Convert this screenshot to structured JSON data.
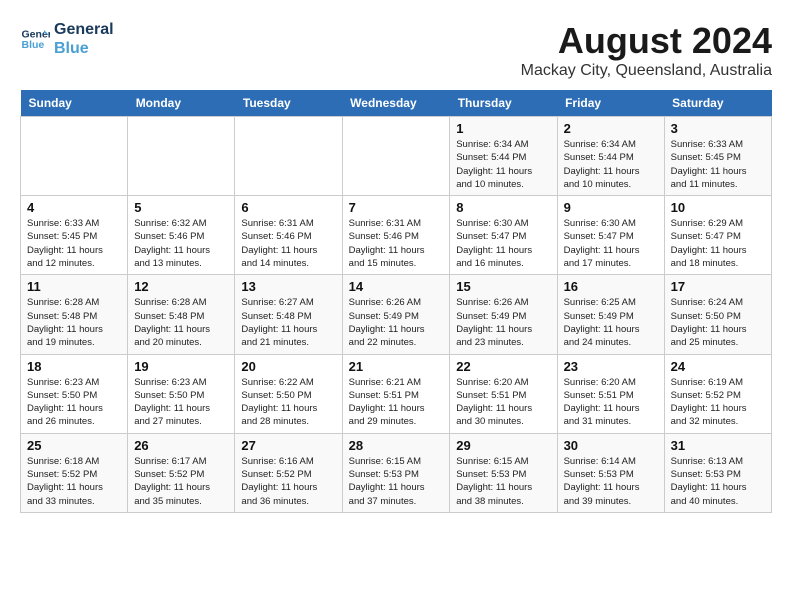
{
  "logo": {
    "line1": "General",
    "line2": "Blue"
  },
  "title": "August 2024",
  "subtitle": "Mackay City, Queensland, Australia",
  "days_of_week": [
    "Sunday",
    "Monday",
    "Tuesday",
    "Wednesday",
    "Thursday",
    "Friday",
    "Saturday"
  ],
  "weeks": [
    [
      {
        "day": "",
        "info": ""
      },
      {
        "day": "",
        "info": ""
      },
      {
        "day": "",
        "info": ""
      },
      {
        "day": "",
        "info": ""
      },
      {
        "day": "1",
        "info": "Sunrise: 6:34 AM\nSunset: 5:44 PM\nDaylight: 11 hours\nand 10 minutes."
      },
      {
        "day": "2",
        "info": "Sunrise: 6:34 AM\nSunset: 5:44 PM\nDaylight: 11 hours\nand 10 minutes."
      },
      {
        "day": "3",
        "info": "Sunrise: 6:33 AM\nSunset: 5:45 PM\nDaylight: 11 hours\nand 11 minutes."
      }
    ],
    [
      {
        "day": "4",
        "info": "Sunrise: 6:33 AM\nSunset: 5:45 PM\nDaylight: 11 hours\nand 12 minutes."
      },
      {
        "day": "5",
        "info": "Sunrise: 6:32 AM\nSunset: 5:46 PM\nDaylight: 11 hours\nand 13 minutes."
      },
      {
        "day": "6",
        "info": "Sunrise: 6:31 AM\nSunset: 5:46 PM\nDaylight: 11 hours\nand 14 minutes."
      },
      {
        "day": "7",
        "info": "Sunrise: 6:31 AM\nSunset: 5:46 PM\nDaylight: 11 hours\nand 15 minutes."
      },
      {
        "day": "8",
        "info": "Sunrise: 6:30 AM\nSunset: 5:47 PM\nDaylight: 11 hours\nand 16 minutes."
      },
      {
        "day": "9",
        "info": "Sunrise: 6:30 AM\nSunset: 5:47 PM\nDaylight: 11 hours\nand 17 minutes."
      },
      {
        "day": "10",
        "info": "Sunrise: 6:29 AM\nSunset: 5:47 PM\nDaylight: 11 hours\nand 18 minutes."
      }
    ],
    [
      {
        "day": "11",
        "info": "Sunrise: 6:28 AM\nSunset: 5:48 PM\nDaylight: 11 hours\nand 19 minutes."
      },
      {
        "day": "12",
        "info": "Sunrise: 6:28 AM\nSunset: 5:48 PM\nDaylight: 11 hours\nand 20 minutes."
      },
      {
        "day": "13",
        "info": "Sunrise: 6:27 AM\nSunset: 5:48 PM\nDaylight: 11 hours\nand 21 minutes."
      },
      {
        "day": "14",
        "info": "Sunrise: 6:26 AM\nSunset: 5:49 PM\nDaylight: 11 hours\nand 22 minutes."
      },
      {
        "day": "15",
        "info": "Sunrise: 6:26 AM\nSunset: 5:49 PM\nDaylight: 11 hours\nand 23 minutes."
      },
      {
        "day": "16",
        "info": "Sunrise: 6:25 AM\nSunset: 5:49 PM\nDaylight: 11 hours\nand 24 minutes."
      },
      {
        "day": "17",
        "info": "Sunrise: 6:24 AM\nSunset: 5:50 PM\nDaylight: 11 hours\nand 25 minutes."
      }
    ],
    [
      {
        "day": "18",
        "info": "Sunrise: 6:23 AM\nSunset: 5:50 PM\nDaylight: 11 hours\nand 26 minutes."
      },
      {
        "day": "19",
        "info": "Sunrise: 6:23 AM\nSunset: 5:50 PM\nDaylight: 11 hours\nand 27 minutes."
      },
      {
        "day": "20",
        "info": "Sunrise: 6:22 AM\nSunset: 5:50 PM\nDaylight: 11 hours\nand 28 minutes."
      },
      {
        "day": "21",
        "info": "Sunrise: 6:21 AM\nSunset: 5:51 PM\nDaylight: 11 hours\nand 29 minutes."
      },
      {
        "day": "22",
        "info": "Sunrise: 6:20 AM\nSunset: 5:51 PM\nDaylight: 11 hours\nand 30 minutes."
      },
      {
        "day": "23",
        "info": "Sunrise: 6:20 AM\nSunset: 5:51 PM\nDaylight: 11 hours\nand 31 minutes."
      },
      {
        "day": "24",
        "info": "Sunrise: 6:19 AM\nSunset: 5:52 PM\nDaylight: 11 hours\nand 32 minutes."
      }
    ],
    [
      {
        "day": "25",
        "info": "Sunrise: 6:18 AM\nSunset: 5:52 PM\nDaylight: 11 hours\nand 33 minutes."
      },
      {
        "day": "26",
        "info": "Sunrise: 6:17 AM\nSunset: 5:52 PM\nDaylight: 11 hours\nand 35 minutes."
      },
      {
        "day": "27",
        "info": "Sunrise: 6:16 AM\nSunset: 5:52 PM\nDaylight: 11 hours\nand 36 minutes."
      },
      {
        "day": "28",
        "info": "Sunrise: 6:15 AM\nSunset: 5:53 PM\nDaylight: 11 hours\nand 37 minutes."
      },
      {
        "day": "29",
        "info": "Sunrise: 6:15 AM\nSunset: 5:53 PM\nDaylight: 11 hours\nand 38 minutes."
      },
      {
        "day": "30",
        "info": "Sunrise: 6:14 AM\nSunset: 5:53 PM\nDaylight: 11 hours\nand 39 minutes."
      },
      {
        "day": "31",
        "info": "Sunrise: 6:13 AM\nSunset: 5:53 PM\nDaylight: 11 hours\nand 40 minutes."
      }
    ]
  ]
}
